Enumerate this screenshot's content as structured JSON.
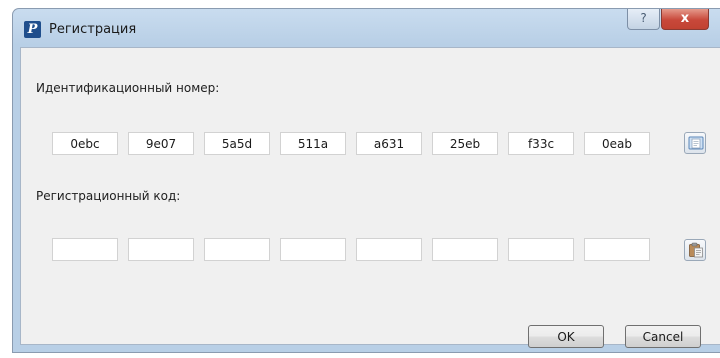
{
  "window": {
    "title": "Регистрация",
    "help_label": "?",
    "close_label": "x"
  },
  "id_section": {
    "label": "Идентификационный номер:",
    "segments": [
      "0ebc",
      "9e07",
      "5a5d",
      "511a",
      "a631",
      "25eb",
      "f33c",
      "0eab"
    ],
    "copy_button_icon": "copy-document-icon"
  },
  "reg_section": {
    "label": "Регистрационный код:",
    "segments": [
      "",
      "",
      "",
      "",
      "",
      "",
      "",
      ""
    ],
    "paste_button_icon": "paste-clipboard-icon"
  },
  "buttons": {
    "ok_label": "OK",
    "cancel_label": "Cancel"
  }
}
